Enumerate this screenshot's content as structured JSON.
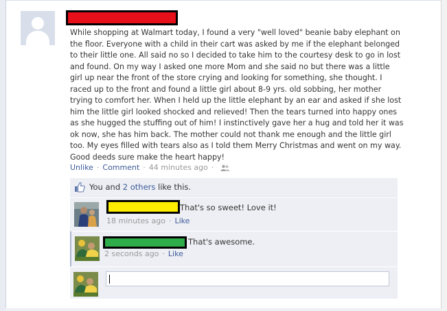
{
  "post": {
    "text": "While shopping at Walmart today, I found a very \"well loved\" beanie baby elephant on\nthe floor. Everyone with a child in their cart was asked by me if the elephant belonged\nto their little one. All said no so I decided to take him to the courtesy desk to go in lost\nand found. On my way I asked one more Mom and she said no but there was a little\ngirl up near the front of the store crying and looking for something, she thought. I\nraced up to the front and found a little girl about 8-9 yrs. old sobbing, her mother\ntrying to comfort her. When I held up the little elephant by an ear and asked if she lost\nhim the little girl looked shocked and relieved! Then the tears turned into happy ones\nas she hugged the stuffing out of him! I instinctively gave her a hug and told her it was\nok now, she has him back. The mother could not thank me enough and the little girl\ntoo. My eyes filled with tears also as I told them Merry Christmas and went on my way.\nGood deeds sure make the heart happy!",
    "unlike_label": "Unlike",
    "comment_label": "Comment",
    "time": "44 minutes ago"
  },
  "likes": {
    "prefix": "You and ",
    "others_link": "2 others",
    "suffix": " like this."
  },
  "comments": [
    {
      "text": "That's so sweet! Love it!",
      "time": "18 minutes ago",
      "like_label": "Like"
    },
    {
      "text": "That's awesome.",
      "time": "2 seconds ago",
      "like_label": "Like"
    }
  ],
  "reply": {
    "value": ""
  },
  "colors": {
    "link": "#3b5998",
    "ufi_bg": "#edeff4",
    "redact_red": "#e60f1a",
    "redact_yellow": "#ffee00",
    "redact_green": "#2fad4b"
  },
  "icons": [
    "default-avatar-icon",
    "people-icon",
    "thumbs-up-icon"
  ]
}
